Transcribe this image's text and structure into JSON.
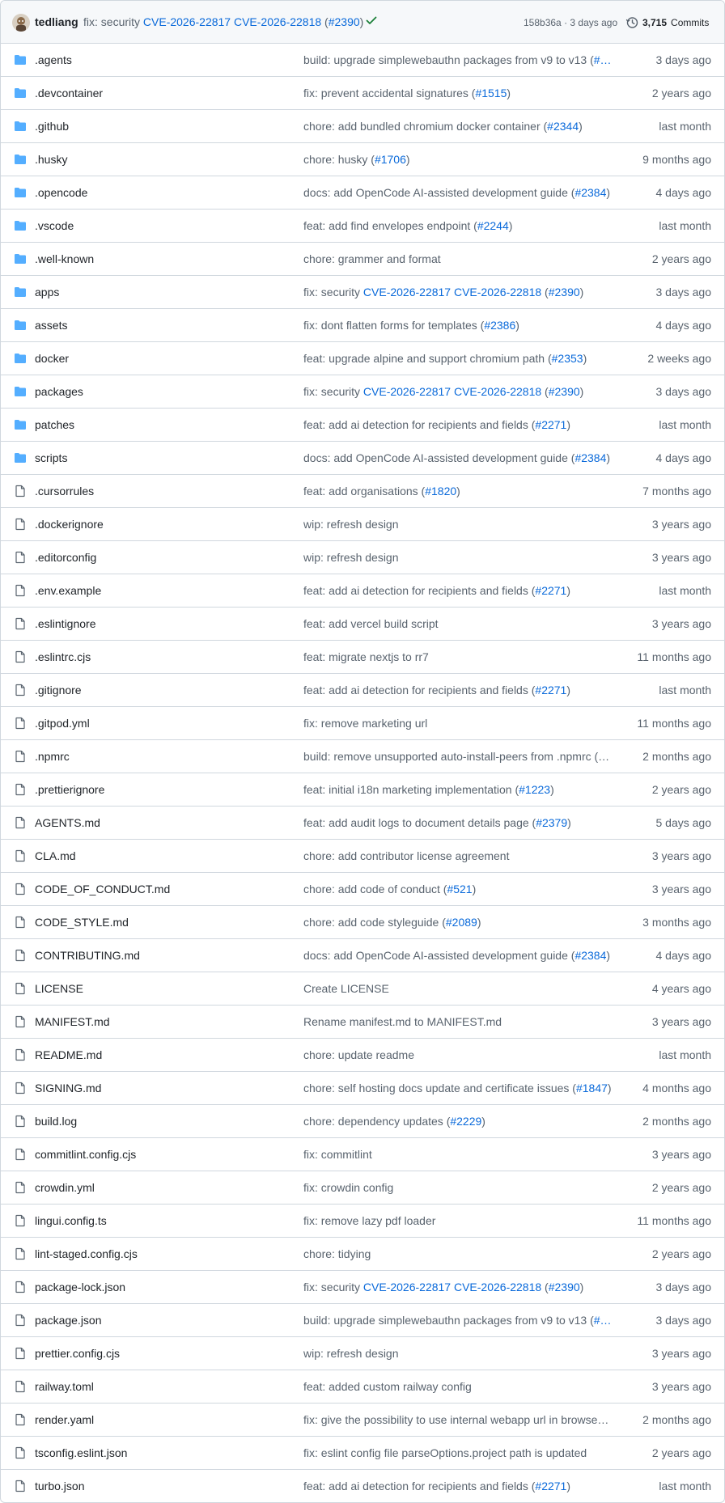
{
  "header": {
    "author": "tedliang",
    "message_parts": [
      "fix: security ",
      "CVE-2026-22817",
      " ",
      "CVE-2026-22818",
      " (",
      "#2390",
      ")"
    ],
    "message_link_flags": [
      false,
      true,
      false,
      true,
      false,
      true,
      false
    ],
    "sha": "158b36a",
    "separator": "·",
    "time": "3 days ago",
    "commits_count": "3,715",
    "commits_label": "Commits",
    "check_icon": "check-icon",
    "history_icon": "history-clock-icon"
  },
  "colors": {
    "folder": "#54aeff",
    "file": "#59636e",
    "link": "#0969da",
    "check": "#1a7f37",
    "muted": "#59636e",
    "border": "#d0d7de",
    "header_bg": "#f6f8fa"
  },
  "files": [
    {
      "type": "folder",
      "name": ".agents",
      "msg": [
        [
          "build: upgrade simplewebauthn packages from v9 to v13 (",
          false
        ],
        [
          "#…",
          true
        ]
      ],
      "date": "3 days ago"
    },
    {
      "type": "folder",
      "name": ".devcontainer",
      "msg": [
        [
          "fix: prevent accidental signatures (",
          false
        ],
        [
          "#1515",
          true
        ],
        [
          ")",
          false
        ]
      ],
      "date": "2 years ago"
    },
    {
      "type": "folder",
      "name": ".github",
      "msg": [
        [
          "chore: add bundled chromium docker container (",
          false
        ],
        [
          "#2344",
          true
        ],
        [
          ")",
          false
        ]
      ],
      "date": "last month"
    },
    {
      "type": "folder",
      "name": ".husky",
      "msg": [
        [
          "chore: husky (",
          false
        ],
        [
          "#1706",
          true
        ],
        [
          ")",
          false
        ]
      ],
      "date": "9 months ago"
    },
    {
      "type": "folder",
      "name": ".opencode",
      "msg": [
        [
          "docs: add OpenCode AI-assisted development guide (",
          false
        ],
        [
          "#2384",
          true
        ],
        [
          ")",
          false
        ]
      ],
      "date": "4 days ago"
    },
    {
      "type": "folder",
      "name": ".vscode",
      "msg": [
        [
          "feat: add find envelopes endpoint (",
          false
        ],
        [
          "#2244",
          true
        ],
        [
          ")",
          false
        ]
      ],
      "date": "last month"
    },
    {
      "type": "folder",
      "name": ".well-known",
      "msg": [
        [
          "chore: grammer and format",
          false
        ]
      ],
      "date": "2 years ago"
    },
    {
      "type": "folder",
      "name": "apps",
      "msg": [
        [
          "fix: security ",
          false
        ],
        [
          "CVE-2026-22817",
          true
        ],
        [
          " ",
          false
        ],
        [
          "CVE-2026-22818",
          true
        ],
        [
          " (",
          false
        ],
        [
          "#2390",
          true
        ],
        [
          ")",
          false
        ]
      ],
      "date": "3 days ago"
    },
    {
      "type": "folder",
      "name": "assets",
      "msg": [
        [
          "fix: dont flatten forms for templates (",
          false
        ],
        [
          "#2386",
          true
        ],
        [
          ")",
          false
        ]
      ],
      "date": "4 days ago"
    },
    {
      "type": "folder",
      "name": "docker",
      "msg": [
        [
          "feat: upgrade alpine and support chromium path (",
          false
        ],
        [
          "#2353",
          true
        ],
        [
          ")",
          false
        ]
      ],
      "date": "2 weeks ago"
    },
    {
      "type": "folder",
      "name": "packages",
      "msg": [
        [
          "fix: security ",
          false
        ],
        [
          "CVE-2026-22817",
          true
        ],
        [
          " ",
          false
        ],
        [
          "CVE-2026-22818",
          true
        ],
        [
          " (",
          false
        ],
        [
          "#2390",
          true
        ],
        [
          ")",
          false
        ]
      ],
      "date": "3 days ago"
    },
    {
      "type": "folder",
      "name": "patches",
      "msg": [
        [
          "feat: add ai detection for recipients and fields (",
          false
        ],
        [
          "#2271",
          true
        ],
        [
          ")",
          false
        ]
      ],
      "date": "last month"
    },
    {
      "type": "folder",
      "name": "scripts",
      "msg": [
        [
          "docs: add OpenCode AI-assisted development guide (",
          false
        ],
        [
          "#2384",
          true
        ],
        [
          ")",
          false
        ]
      ],
      "date": "4 days ago"
    },
    {
      "type": "file",
      "name": ".cursorrules",
      "msg": [
        [
          "feat: add organisations (",
          false
        ],
        [
          "#1820",
          true
        ],
        [
          ")",
          false
        ]
      ],
      "date": "7 months ago"
    },
    {
      "type": "file",
      "name": ".dockerignore",
      "msg": [
        [
          "wip: refresh design",
          false
        ]
      ],
      "date": "3 years ago"
    },
    {
      "type": "file",
      "name": ".editorconfig",
      "msg": [
        [
          "wip: refresh design",
          false
        ]
      ],
      "date": "3 years ago"
    },
    {
      "type": "file",
      "name": ".env.example",
      "msg": [
        [
          "feat: add ai detection for recipients and fields (",
          false
        ],
        [
          "#2271",
          true
        ],
        [
          ")",
          false
        ]
      ],
      "date": "last month"
    },
    {
      "type": "file",
      "name": ".eslintignore",
      "msg": [
        [
          "feat: add vercel build script",
          false
        ]
      ],
      "date": "3 years ago"
    },
    {
      "type": "file",
      "name": ".eslintrc.cjs",
      "msg": [
        [
          "feat: migrate nextjs to rr7",
          false
        ]
      ],
      "date": "11 months ago"
    },
    {
      "type": "file",
      "name": ".gitignore",
      "msg": [
        [
          "feat: add ai detection for recipients and fields (",
          false
        ],
        [
          "#2271",
          true
        ],
        [
          ")",
          false
        ]
      ],
      "date": "last month"
    },
    {
      "type": "file",
      "name": ".gitpod.yml",
      "msg": [
        [
          "fix: remove marketing url",
          false
        ]
      ],
      "date": "11 months ago"
    },
    {
      "type": "file",
      "name": ".npmrc",
      "msg": [
        [
          "build: remove unsupported auto-install-peers from .npmrc (…",
          false
        ]
      ],
      "date": "2 months ago"
    },
    {
      "type": "file",
      "name": ".prettierignore",
      "msg": [
        [
          "feat: initial i18n marketing implementation (",
          false
        ],
        [
          "#1223",
          true
        ],
        [
          ")",
          false
        ]
      ],
      "date": "2 years ago"
    },
    {
      "type": "file",
      "name": "AGENTS.md",
      "msg": [
        [
          "feat: add audit logs to document details page (",
          false
        ],
        [
          "#2379",
          true
        ],
        [
          ")",
          false
        ]
      ],
      "date": "5 days ago"
    },
    {
      "type": "file",
      "name": "CLA.md",
      "msg": [
        [
          "chore: add contributor license agreement",
          false
        ]
      ],
      "date": "3 years ago"
    },
    {
      "type": "file",
      "name": "CODE_OF_CONDUCT.md",
      "msg": [
        [
          "chore: add code of conduct (",
          false
        ],
        [
          "#521",
          true
        ],
        [
          ")",
          false
        ]
      ],
      "date": "3 years ago"
    },
    {
      "type": "file",
      "name": "CODE_STYLE.md",
      "msg": [
        [
          "chore: add code styleguide (",
          false
        ],
        [
          "#2089",
          true
        ],
        [
          ")",
          false
        ]
      ],
      "date": "3 months ago"
    },
    {
      "type": "file",
      "name": "CONTRIBUTING.md",
      "msg": [
        [
          "docs: add OpenCode AI-assisted development guide (",
          false
        ],
        [
          "#2384",
          true
        ],
        [
          ")",
          false
        ]
      ],
      "date": "4 days ago"
    },
    {
      "type": "file",
      "name": "LICENSE",
      "msg": [
        [
          "Create LICENSE",
          false
        ]
      ],
      "date": "4 years ago"
    },
    {
      "type": "file",
      "name": "MANIFEST.md",
      "msg": [
        [
          "Rename manifest.md to MANIFEST.md",
          false
        ]
      ],
      "date": "3 years ago"
    },
    {
      "type": "file",
      "name": "README.md",
      "msg": [
        [
          "chore: update readme",
          false
        ]
      ],
      "date": "last month"
    },
    {
      "type": "file",
      "name": "SIGNING.md",
      "msg": [
        [
          "chore: self hosting docs update and certificate issues (",
          false
        ],
        [
          "#1847",
          true
        ],
        [
          ")",
          false
        ]
      ],
      "date": "4 months ago"
    },
    {
      "type": "file",
      "name": "build.log",
      "msg": [
        [
          "chore: dependency updates (",
          false
        ],
        [
          "#2229",
          true
        ],
        [
          ")",
          false
        ]
      ],
      "date": "2 months ago"
    },
    {
      "type": "file",
      "name": "commitlint.config.cjs",
      "msg": [
        [
          "fix: commitlint",
          false
        ]
      ],
      "date": "3 years ago"
    },
    {
      "type": "file",
      "name": "crowdin.yml",
      "msg": [
        [
          "fix: crowdin config",
          false
        ]
      ],
      "date": "2 years ago"
    },
    {
      "type": "file",
      "name": "lingui.config.ts",
      "msg": [
        [
          "fix: remove lazy pdf loader",
          false
        ]
      ],
      "date": "11 months ago"
    },
    {
      "type": "file",
      "name": "lint-staged.config.cjs",
      "msg": [
        [
          "chore: tidying",
          false
        ]
      ],
      "date": "2 years ago"
    },
    {
      "type": "file",
      "name": "package-lock.json",
      "msg": [
        [
          "fix: security ",
          false
        ],
        [
          "CVE-2026-22817",
          true
        ],
        [
          " ",
          false
        ],
        [
          "CVE-2026-22818",
          true
        ],
        [
          " (",
          false
        ],
        [
          "#2390",
          true
        ],
        [
          ")",
          false
        ]
      ],
      "date": "3 days ago"
    },
    {
      "type": "file",
      "name": "package.json",
      "msg": [
        [
          "build: upgrade simplewebauthn packages from v9 to v13 (",
          false
        ],
        [
          "#…",
          true
        ]
      ],
      "date": "3 days ago"
    },
    {
      "type": "file",
      "name": "prettier.config.cjs",
      "msg": [
        [
          "wip: refresh design",
          false
        ]
      ],
      "date": "3 years ago"
    },
    {
      "type": "file",
      "name": "railway.toml",
      "msg": [
        [
          "feat: added custom railway config",
          false
        ]
      ],
      "date": "3 years ago"
    },
    {
      "type": "file",
      "name": "render.yaml",
      "msg": [
        [
          "fix: give the possibility to use internal webapp url in browserl…",
          false
        ]
      ],
      "date": "2 months ago"
    },
    {
      "type": "file",
      "name": "tsconfig.eslint.json",
      "msg": [
        [
          "fix: eslint config file parseOptions.project path is updated",
          false
        ]
      ],
      "date": "2 years ago"
    },
    {
      "type": "file",
      "name": "turbo.json",
      "msg": [
        [
          "feat: add ai detection for recipients and fields (",
          false
        ],
        [
          "#2271",
          true
        ],
        [
          ")",
          false
        ]
      ],
      "date": "last month"
    }
  ]
}
